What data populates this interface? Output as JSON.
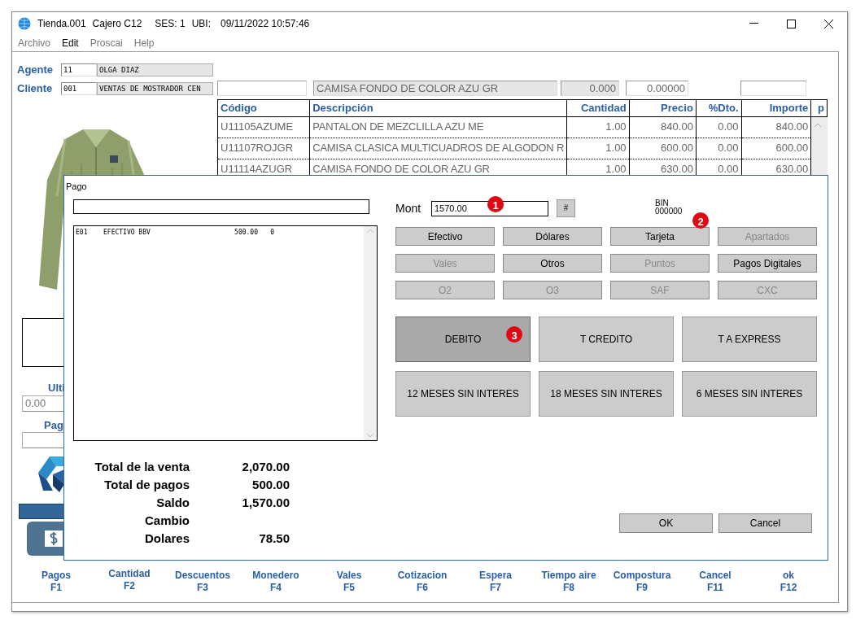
{
  "window": {
    "title_parts": [
      "Tienda.001",
      "Cajero C12",
      "SES: 1",
      "UBI:",
      "09/11/2022 10:57:46"
    ]
  },
  "menu": [
    {
      "label": "Archivo",
      "selected": false
    },
    {
      "label": "Edit",
      "selected": true
    },
    {
      "label": "Proscai",
      "selected": false
    },
    {
      "label": "Help",
      "selected": false
    }
  ],
  "agente": {
    "label": "Agente",
    "code": "11",
    "name": "OLGA DIAZ"
  },
  "cliente": {
    "label": "Cliente",
    "code": "001",
    "name": "VENTAS DE MOSTRADOR CEN"
  },
  "item_entry": {
    "description": "CAMISA FONDO DE COLOR AZU GR",
    "quantity": "0.000",
    "price": "0.00000"
  },
  "table": {
    "columns": [
      "Código",
      "Descripción",
      "Cantidad",
      "Precio",
      "%Dto.",
      "Importe",
      "p"
    ],
    "rows": [
      [
        "U11105AZUME",
        "PANTALON DE MEZCLILLA AZU ME",
        "1.00",
        "840.00",
        "0.00",
        "840.00"
      ],
      [
        "U11107ROJGR",
        "CAMISA CLASICA MULTICUADROS DE ALGODON R",
        "1.00",
        "600.00",
        "0.00",
        "600.00"
      ],
      [
        "U11114AZUGR",
        "CAMISA FONDO DE COLOR AZU GR",
        "1.00",
        "630.00",
        "0.00",
        "630.00"
      ]
    ]
  },
  "left_panel": {
    "label_1": "Ulti",
    "field_1": "0.00",
    "label_2": "Pag"
  },
  "function_keys": [
    {
      "label": "Pagos",
      "key": "F1"
    },
    {
      "label": "Cantidad",
      "key": "F2"
    },
    {
      "label": "Descuentos",
      "key": "F3"
    },
    {
      "label": "Monedero",
      "key": "F4"
    },
    {
      "label": "Vales",
      "key": "F5"
    },
    {
      "label": "Cotizacion",
      "key": "F6"
    },
    {
      "label": "Espera",
      "key": "F7"
    },
    {
      "label": "Tiempo aire",
      "key": "F8"
    },
    {
      "label": "Compostura",
      "key": "F9"
    },
    {
      "label": "Cancel",
      "key": "F11"
    },
    {
      "label": "ok",
      "key": "F12"
    }
  ],
  "dialog": {
    "title": "Pago",
    "payments": [
      {
        "code": "E01",
        "name": "EFECTIVO BBV",
        "amount": "500.00",
        "column_4": "0"
      }
    ],
    "totals": [
      {
        "label": "Total de la venta",
        "value": "2,070.00"
      },
      {
        "label": "Total de pagos",
        "value": "500.00"
      },
      {
        "label": "Saldo",
        "value": "1,570.00"
      },
      {
        "label": "Cambio"
      },
      {
        "label": "Dolares",
        "value": "78.50"
      }
    ],
    "amount": {
      "label": "Mont",
      "value": "1570.00"
    },
    "hash_button": "#",
    "bin": {
      "label": "BIN",
      "value": "000000"
    },
    "payment_types": [
      {
        "label": "Efectivo",
        "disabled": false
      },
      {
        "label": "Dólares",
        "disabled": false
      },
      {
        "label": "Tarjeta",
        "disabled": false
      },
      {
        "label": "Apartados",
        "disabled": true
      },
      {
        "label": "Vales",
        "disabled": true
      },
      {
        "label": "Otros",
        "disabled": false
      },
      {
        "label": "Puntos",
        "disabled": true
      },
      {
        "label": "Pagos Digitales",
        "disabled": false
      },
      {
        "label": "O2",
        "disabled": true
      },
      {
        "label": "O3",
        "disabled": true
      },
      {
        "label": "SAF",
        "disabled": true
      },
      {
        "label": "CXC",
        "disabled": true
      }
    ],
    "card_types": [
      {
        "label": "DEBITO",
        "selected": true
      },
      {
        "label": "T CREDITO",
        "selected": false
      },
      {
        "label": "T A EXPRESS",
        "selected": false
      },
      {
        "label": "12 MESES SIN INTERES",
        "selected": false
      },
      {
        "label": "18 MESES SIN INTERES",
        "selected": false
      },
      {
        "label": "6 MESES SIN INTERES",
        "selected": false
      }
    ],
    "buttons": [
      "OK",
      "Cancel"
    ],
    "markers": [
      "1",
      "2",
      "3"
    ]
  }
}
